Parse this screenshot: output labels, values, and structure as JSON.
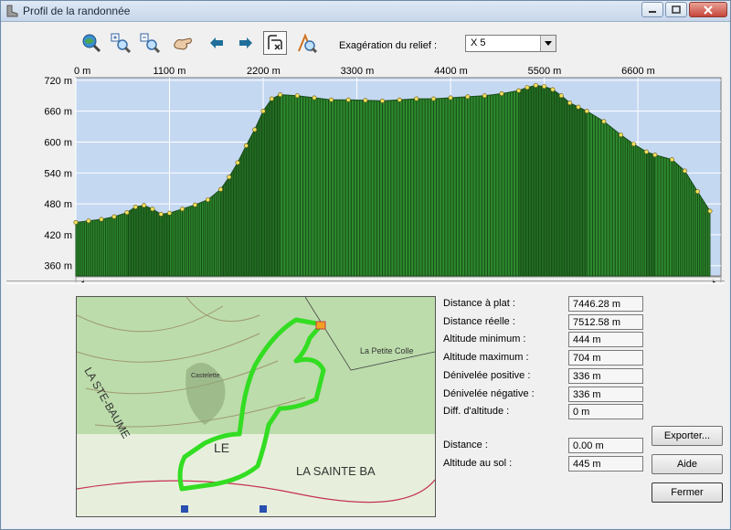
{
  "window": {
    "title": "Profil de la randonnée"
  },
  "toolbar": {
    "icons": [
      "globe-zoom-icon",
      "zoom-in-icon",
      "zoom-out-icon",
      "pan-hand-icon",
      "arrow-left-icon",
      "arrow-right-icon",
      "route-profile-icon",
      "cursor-profile-icon"
    ],
    "relief_label": "Exagération du relief :",
    "relief_value": "X 5"
  },
  "chart_data": {
    "type": "area",
    "x_unit": "m",
    "y_unit": "m",
    "x_ticks": [
      "0 m",
      "1100 m",
      "2200 m",
      "3300 m",
      "4400 m",
      "5500 m",
      "6600 m"
    ],
    "y_ticks": [
      "720 m",
      "660 m",
      "600 m",
      "540 m",
      "480 m",
      "420 m",
      "360 m"
    ],
    "xlim": [
      0,
      7446
    ],
    "ylim": [
      340,
      725
    ],
    "x": [
      0,
      150,
      300,
      450,
      600,
      700,
      800,
      900,
      1000,
      1100,
      1250,
      1400,
      1550,
      1700,
      1800,
      1900,
      2000,
      2100,
      2200,
      2300,
      2400,
      2600,
      2800,
      3000,
      3200,
      3400,
      3600,
      3800,
      4000,
      4200,
      4400,
      4600,
      4800,
      5000,
      5200,
      5300,
      5400,
      5500,
      5600,
      5700,
      5800,
      5900,
      6000,
      6200,
      6400,
      6550,
      6700,
      6800,
      7000,
      7150,
      7300,
      7446
    ],
    "y": [
      444,
      447,
      450,
      455,
      463,
      474,
      477,
      470,
      460,
      462,
      470,
      478,
      488,
      508,
      532,
      560,
      593,
      624,
      660,
      684,
      692,
      690,
      686,
      682,
      682,
      681,
      680,
      682,
      684,
      684,
      686,
      688,
      690,
      694,
      700,
      706,
      710,
      708,
      702,
      690,
      676,
      668,
      660,
      640,
      614,
      596,
      581,
      575,
      566,
      544,
      504,
      466
    ],
    "fill_color": "#2e8b2e",
    "sky_color": "#c5d8f2",
    "point_color": "#f0e060"
  },
  "stats": [
    {
      "label": "Distance à plat :",
      "value": "7446.28 m"
    },
    {
      "label": "Distance réelle :",
      "value": "7512.58 m"
    },
    {
      "label": "Altitude minimum :",
      "value": "444 m"
    },
    {
      "label": "Altitude maximum :",
      "value": "704 m"
    },
    {
      "label": "Dénivelée positive :",
      "value": "336 m"
    },
    {
      "label": "Dénivelée négative :",
      "value": "336 m"
    },
    {
      "label": "Diff. d'altitude :",
      "value": "0 m"
    }
  ],
  "cursor": [
    {
      "label": "Distance :",
      "value": "0.00 m"
    },
    {
      "label": "Altitude au sol :",
      "value": "445 m"
    }
  ],
  "buttons": {
    "export": "Exporter...",
    "help": "Aide",
    "close": "Fermer"
  },
  "map": {
    "labels": [
      "LA STE-BAUME",
      "LE",
      "LA SAINTE BA",
      "La Petite Colle",
      "Castelette"
    ],
    "route_color": "#33dd22"
  }
}
